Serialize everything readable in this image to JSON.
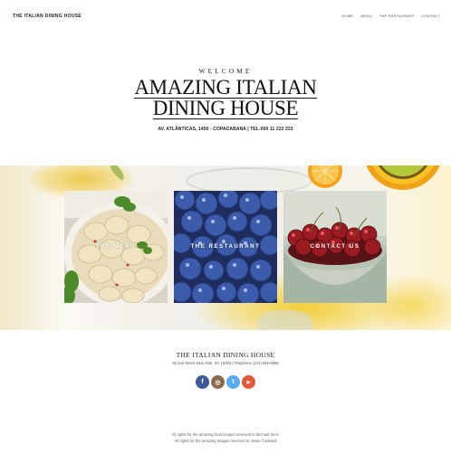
{
  "header": {
    "brand": "THE ITALIAN DINING HOUSE",
    "nav": [
      "HOME",
      "MENU",
      "THE RESTAURANT",
      "CONTACT"
    ]
  },
  "hero": {
    "welcome": "WELCOME",
    "headline_line1": "AMAZING ITALIAN",
    "headline_line2": "DINING HOUSE",
    "address": "AV. ATLÂNTICAS, 1450 - COPACABANA | TEL:000 11 222 333"
  },
  "cards": [
    {
      "label": "THE MENU",
      "image": "dumplings"
    },
    {
      "label": "THE RESTAURANT",
      "image": "blueberries"
    },
    {
      "label": "CONTACT US",
      "image": "cherries"
    }
  ],
  "footer": {
    "title": "THE ITALIAN DINING HOUSE",
    "address": "92 2nd Street New York, NY 10003 | Telephone (212) 555-5555",
    "socials": [
      {
        "name": "facebook",
        "glyph": "f",
        "color": "#3b5998"
      },
      {
        "name": "instagram",
        "glyph": "◎",
        "color": "#8a6a4f"
      },
      {
        "name": "twitter",
        "glyph": "t",
        "color": "#55acee"
      },
      {
        "name": "youtube",
        "glyph": "▶",
        "color": "#e05a3a"
      }
    ],
    "credit_line1": "All rights for the amazing food images reserved to Michael Stern",
    "credit_line2": "All rights for the amazing images reserved to Jesse Cockwell"
  }
}
